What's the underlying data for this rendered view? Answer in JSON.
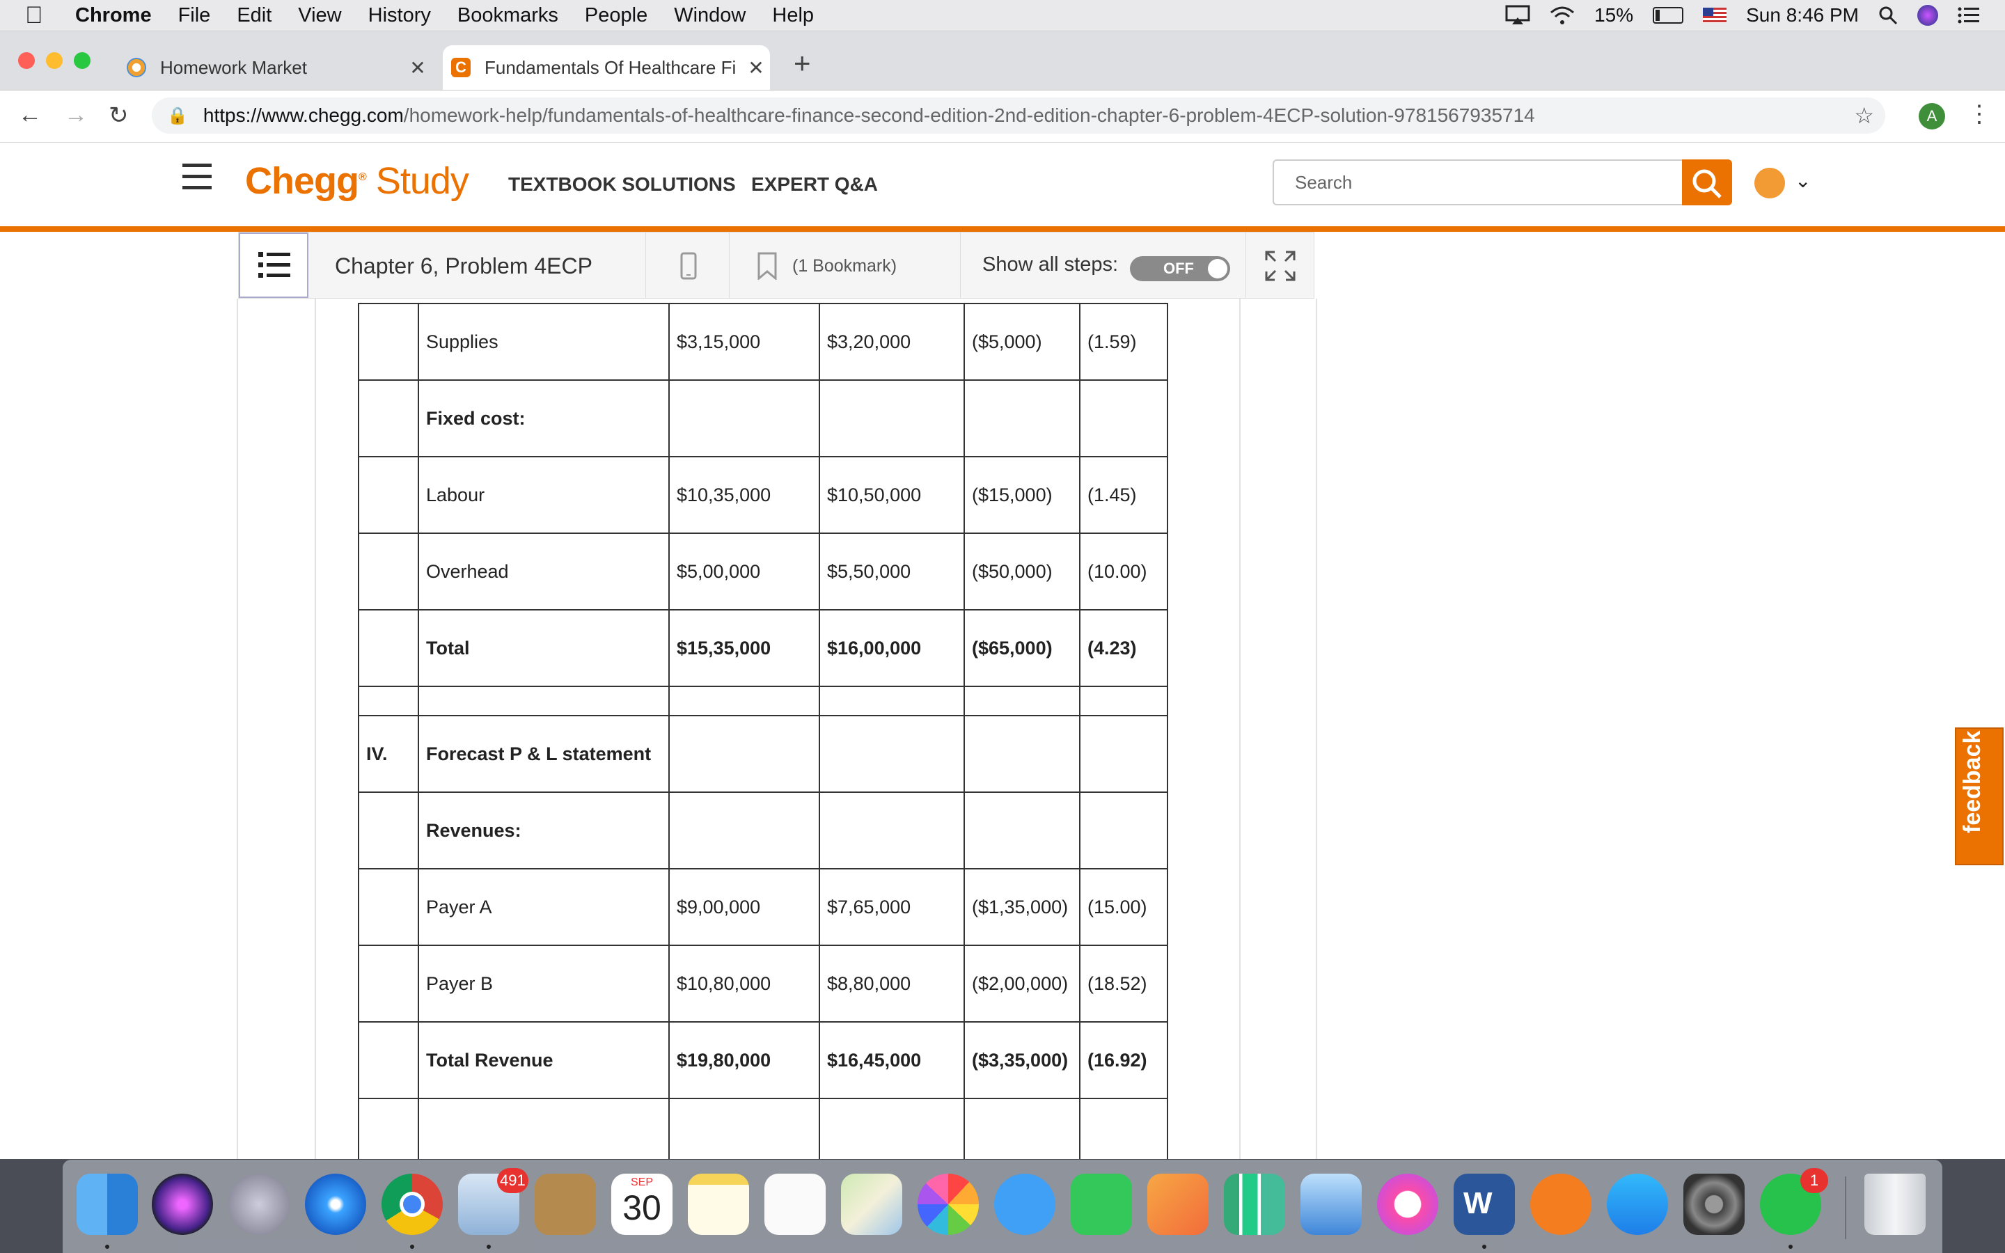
{
  "menubar": {
    "app": "Chrome",
    "items": [
      "File",
      "Edit",
      "View",
      "History",
      "Bookmarks",
      "People",
      "Window",
      "Help"
    ],
    "battery": "15%",
    "clock": "Sun 8:46 PM"
  },
  "tabs": [
    {
      "title": "Homework Market",
      "active": false
    },
    {
      "title": "Fundamentals Of Healthcare Fi",
      "active": true
    }
  ],
  "address": {
    "host": "https://www.chegg.com",
    "path": "/homework-help/fundamentals-of-healthcare-finance-second-edition-2nd-edition-chapter-6-problem-4ECP-solution-9781567935714",
    "profile_initial": "A"
  },
  "chegg": {
    "logo_main": "Chegg",
    "logo_study": "Study",
    "nav": [
      "TEXTBOOK SOLUTIONS",
      "EXPERT Q&A"
    ],
    "search_placeholder": "Search"
  },
  "problem_bar": {
    "title": "Chapter 6, Problem 4ECP",
    "bookmark": "(1 Bookmark)",
    "show_steps": "Show all steps:",
    "toggle": "OFF"
  },
  "table": {
    "rows": [
      {
        "c1": "",
        "c2": "Supplies",
        "c3": "$3,15,000",
        "c4": "$3,20,000",
        "c5": "($5,000)",
        "c6": "(1.59)",
        "bold": false
      },
      {
        "c1": "",
        "c2": "Fixed cost:",
        "c3": "",
        "c4": "",
        "c5": "",
        "c6": "",
        "bold": true
      },
      {
        "c1": "",
        "c2": "Labour",
        "c3": "$10,35,000",
        "c4": "$10,50,000",
        "c5": "($15,000)",
        "c6": "(1.45)",
        "bold": false
      },
      {
        "c1": "",
        "c2": "Overhead",
        "c3": "$5,00,000",
        "c4": "$5,50,000",
        "c5": "($50,000)",
        "c6": "(10.00)",
        "bold": false
      },
      {
        "c1": "",
        "c2": "Total",
        "c3": "$15,35,000",
        "c4": "$16,00,000",
        "c5": "($65,000)",
        "c6": "(4.23)",
        "bold": true
      },
      {
        "spacer": true
      },
      {
        "c1": "IV.",
        "c2": "Forecast P & L statement",
        "c3": "",
        "c4": "",
        "c5": "",
        "c6": "",
        "bold": true
      },
      {
        "c1": "",
        "c2": "Revenues:",
        "c3": "",
        "c4": "",
        "c5": "",
        "c6": "",
        "bold": true
      },
      {
        "c1": "",
        "c2": "Payer A",
        "c3": "$9,00,000",
        "c4": "$7,65,000",
        "c5": "($1,35,000)",
        "c6": "(15.00)",
        "bold": false
      },
      {
        "c1": "",
        "c2": "Payer B",
        "c3": "$10,80,000",
        "c4": "$8,80,000",
        "c5": "($2,00,000)",
        "c6": "(18.52)",
        "bold": false
      },
      {
        "c1": "",
        "c2": "Total Revenue",
        "c3": "$19,80,000",
        "c4": "$16,45,000",
        "c5": "($3,35,000)",
        "c6": "(16.92)",
        "bold": true
      },
      {
        "c1": "",
        "c2": "",
        "c3": "",
        "c4": "",
        "c5": "",
        "c6": "",
        "bold": false
      }
    ]
  },
  "feedback": "feedback",
  "dock": {
    "mail_badge": "491",
    "calendar_month": "SEP",
    "calendar_day": "30",
    "word_letter": "W",
    "whatsapp_badge": "1"
  },
  "colors": {
    "chegg_orange": "#eb7100",
    "toggle_off": "#8a8a8a"
  }
}
